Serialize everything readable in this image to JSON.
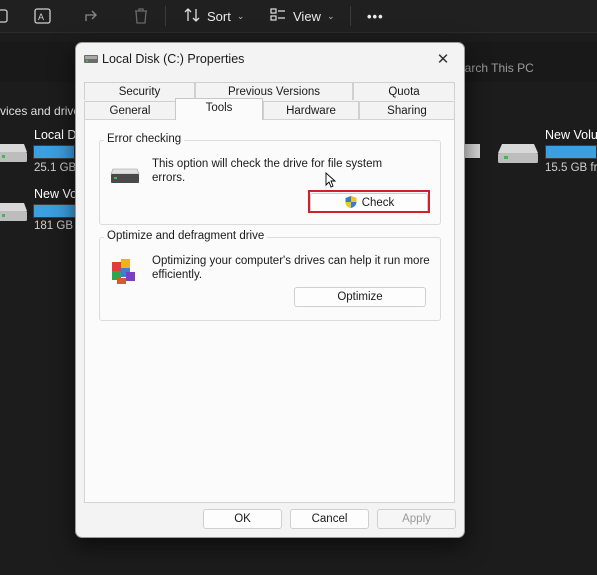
{
  "explorer": {
    "toolbar": {
      "sort_label": "Sort",
      "view_label": "View",
      "more_label": "•••"
    },
    "search_placeholder": "earch This PC",
    "section_label": "vices and drive",
    "drives": [
      {
        "name": "Local D",
        "size": "25.1 GB",
        "fill": 0.9
      },
      {
        "name": "New Vol",
        "size": "181 GB",
        "fill": 0.95
      },
      {
        "name": "New Volu",
        "size": "15.5 GB fr",
        "fill": 0.9
      }
    ]
  },
  "dialog": {
    "title": "Local Disk (C:) Properties",
    "close_icon": "close-icon",
    "tabs_row1": [
      "Security",
      "Previous Versions",
      "Quota"
    ],
    "tabs_row2": [
      "General",
      "Tools",
      "Hardware",
      "Sharing"
    ],
    "active_tab": "Tools",
    "error_checking": {
      "label": "Error checking",
      "description_line1": "This option will check the drive for file system",
      "description_line2": "errors.",
      "button": "Check"
    },
    "optimize": {
      "label": "Optimize and defragment drive",
      "description_line1": "Optimizing your computer's drives can help it run more",
      "description_line2": "efficiently.",
      "button": "Optimize"
    },
    "footer": {
      "ok": "OK",
      "cancel": "Cancel",
      "apply": "Apply"
    }
  },
  "colors": {
    "highlight": "#d0202a",
    "drive_fill": "#3b9fe0"
  }
}
